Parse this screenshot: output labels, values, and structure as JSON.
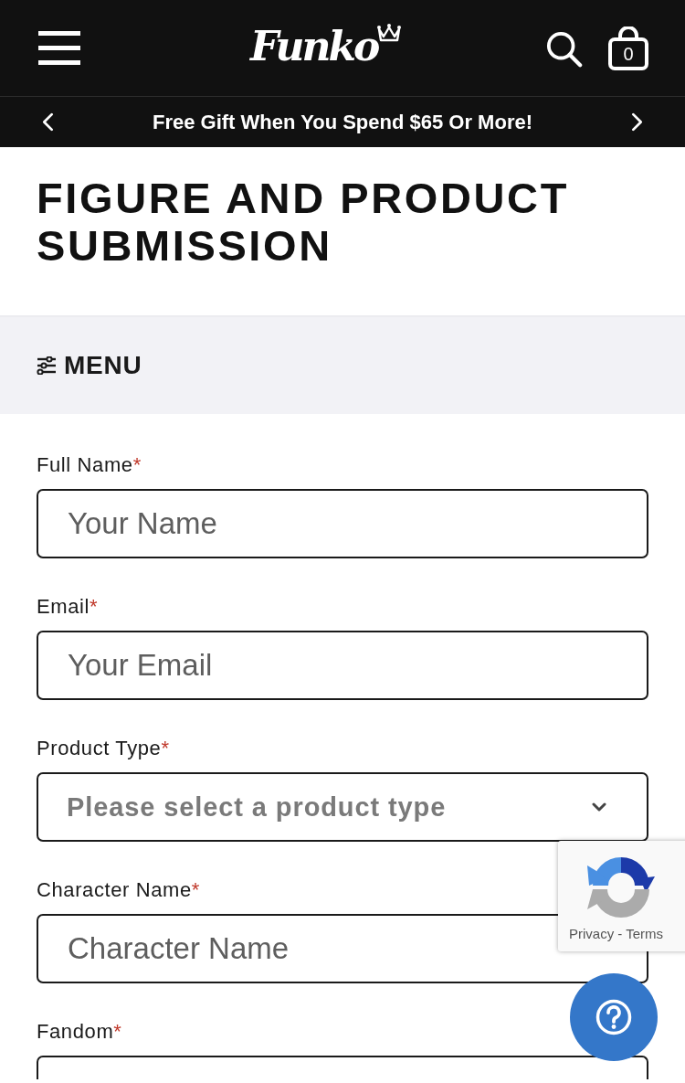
{
  "header": {
    "logo": "Funko",
    "cart_count": "0"
  },
  "promo": {
    "text": "Free Gift When You Spend $65 Or More!"
  },
  "page_title": "FIGURE AND PRODUCT SUBMISSION",
  "menu_bar": {
    "label": "MENU"
  },
  "form": {
    "fields": [
      {
        "kind": "text",
        "label": "Full Name",
        "required_mark": "*",
        "placeholder": "Your Name"
      },
      {
        "kind": "text",
        "label": "Email",
        "required_mark": "*",
        "placeholder": "Your Email"
      },
      {
        "kind": "select",
        "label": "Product Type",
        "required_mark": "*",
        "placeholder": "Please select a product type"
      },
      {
        "kind": "text",
        "label": "Character Name",
        "required_mark": "*",
        "placeholder": "Character Name"
      },
      {
        "kind": "text",
        "label": "Fandom",
        "required_mark": "*"
      }
    ]
  },
  "recaptcha": {
    "privacy_link": "Privacy",
    "separator": "-",
    "terms_link": "Terms"
  }
}
